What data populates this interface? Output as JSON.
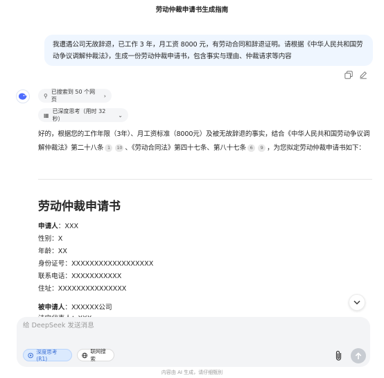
{
  "header": {
    "title": "劳动仲裁申请书生成指南"
  },
  "user_message": {
    "text": "我遭遇公司无故辞退，已工作 3 年，月工资 8000 元，有劳动合同和辞退证明。请根据《中华人民共和国劳动争议调解仲裁法》，生成一份劳动仲裁申请书，包含事实与理由、仲裁请求等内容",
    "actions": [
      "copy-icon",
      "edit-icon"
    ]
  },
  "assistant": {
    "avatar_icon": "deepseek-whale-icon",
    "search_chip": "已搜索到 50 个网页",
    "think_chip": "已深度思考（用时 32 秒）",
    "intro": {
      "p1": "好的，根据您的工作年限（3年）、月工资标准（8000元）及被无故辞退的事实，结合《中华人民共和国劳动争议调解仲裁法》第二十八条",
      "c1": "1",
      "c2": "10",
      "p2": "、《劳动合同法》第四十七条、第八十七条",
      "c3": "6",
      "c4": "9",
      "p3": "，为您拟定劳动仲裁申请书如下："
    },
    "document": {
      "title": "劳动仲裁申请书",
      "applicant_label": "申请人",
      "applicant_value": "：XXX",
      "gender": "性别：X",
      "age": "年龄：XX",
      "id_number": "身份证号：XXXXXXXXXXXXXXXXXX",
      "phone": "联系电话：XXXXXXXXXXX",
      "address": "住址：XXXXXXXXXXXXXXX",
      "respondent_label": "被申请人",
      "respondent_value": "：XXXXXX公司",
      "legal_rep": "法定代表人：XXX"
    }
  },
  "composer": {
    "placeholder": "给 DeepSeek 发送消息",
    "deep_think_label": "深度思考 (R1)",
    "web_search_label": "联网搜索"
  },
  "footer": {
    "note": "内容由 AI 生成，请仔细甄别"
  },
  "colors": {
    "accent": "#3b6fd4",
    "bubble": "#eff6ff",
    "composer": "#f3f4f6"
  }
}
